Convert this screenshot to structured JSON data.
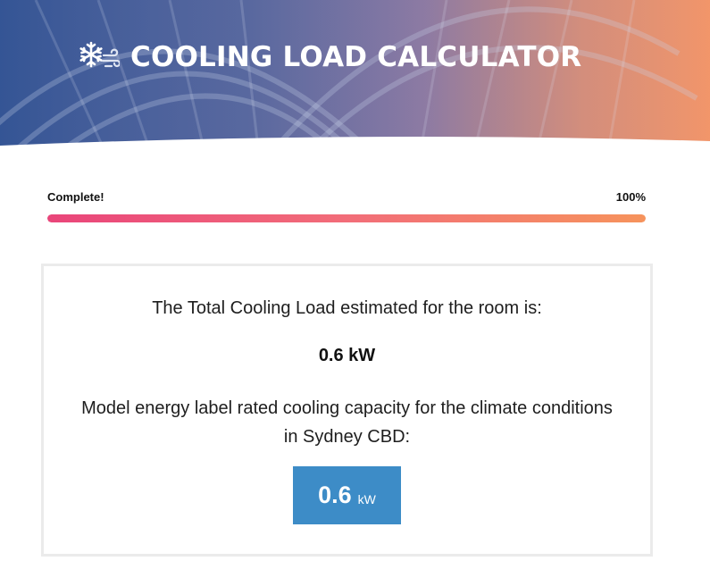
{
  "header": {
    "title": "COOLING LOAD CALCULATOR",
    "icon": "snowflake-wind-icon"
  },
  "progress": {
    "label": "Complete!",
    "percent_label": "100%",
    "value": 1.0
  },
  "result": {
    "intro": "The Total Cooling Load estimated for the room is:",
    "total_load": "0.6 kW",
    "model_text": "Model energy label rated cooling capacity for the climate conditions in Sydney CBD:",
    "capacity_value": "0.6",
    "capacity_unit": "kW"
  },
  "colors": {
    "accent_blue": "#3d8cc7",
    "progress_start": "#e9457a",
    "progress_end": "#f6935c",
    "card_border": "#ebebeb"
  }
}
